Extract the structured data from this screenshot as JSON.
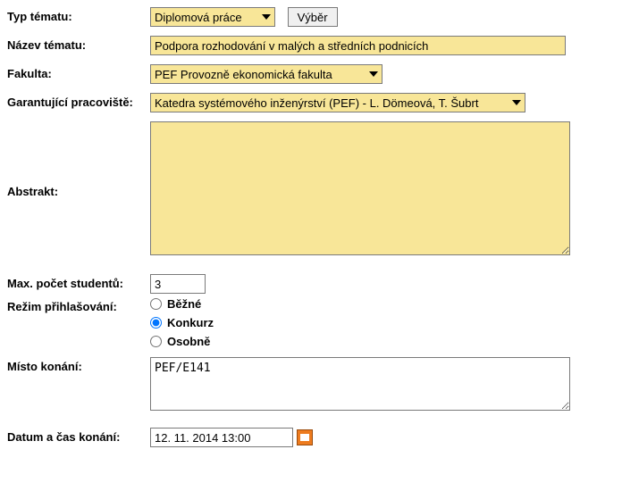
{
  "labels": {
    "topic_type": "Typ tématu:",
    "topic_name": "Název tématu:",
    "faculty": "Fakulta:",
    "department": "Garantující pracoviště:",
    "abstract": "Abstrakt:",
    "max_students": "Max. počet studentů:",
    "signup_mode": "Režim přihlašování:",
    "venue": "Místo konání:",
    "date_time": "Datum a čas konání:",
    "select_button": "Výběr"
  },
  "values": {
    "topic_type": "Diplomová práce",
    "topic_name": "Podpora rozhodování v malých a středních podnicích",
    "faculty": "PEF Provozně ekonomická fakulta",
    "department": "Katedra systémového inženýrství (PEF) - L. Dömeová, T. Šubrt",
    "abstract": "",
    "max_students": "3",
    "venue": "PEF/E141",
    "date_time": "12. 11. 2014 13:00"
  },
  "signup_modes": {
    "normal": "Běžné",
    "contest": "Konkurz",
    "personal": "Osobně",
    "selected": "contest"
  }
}
